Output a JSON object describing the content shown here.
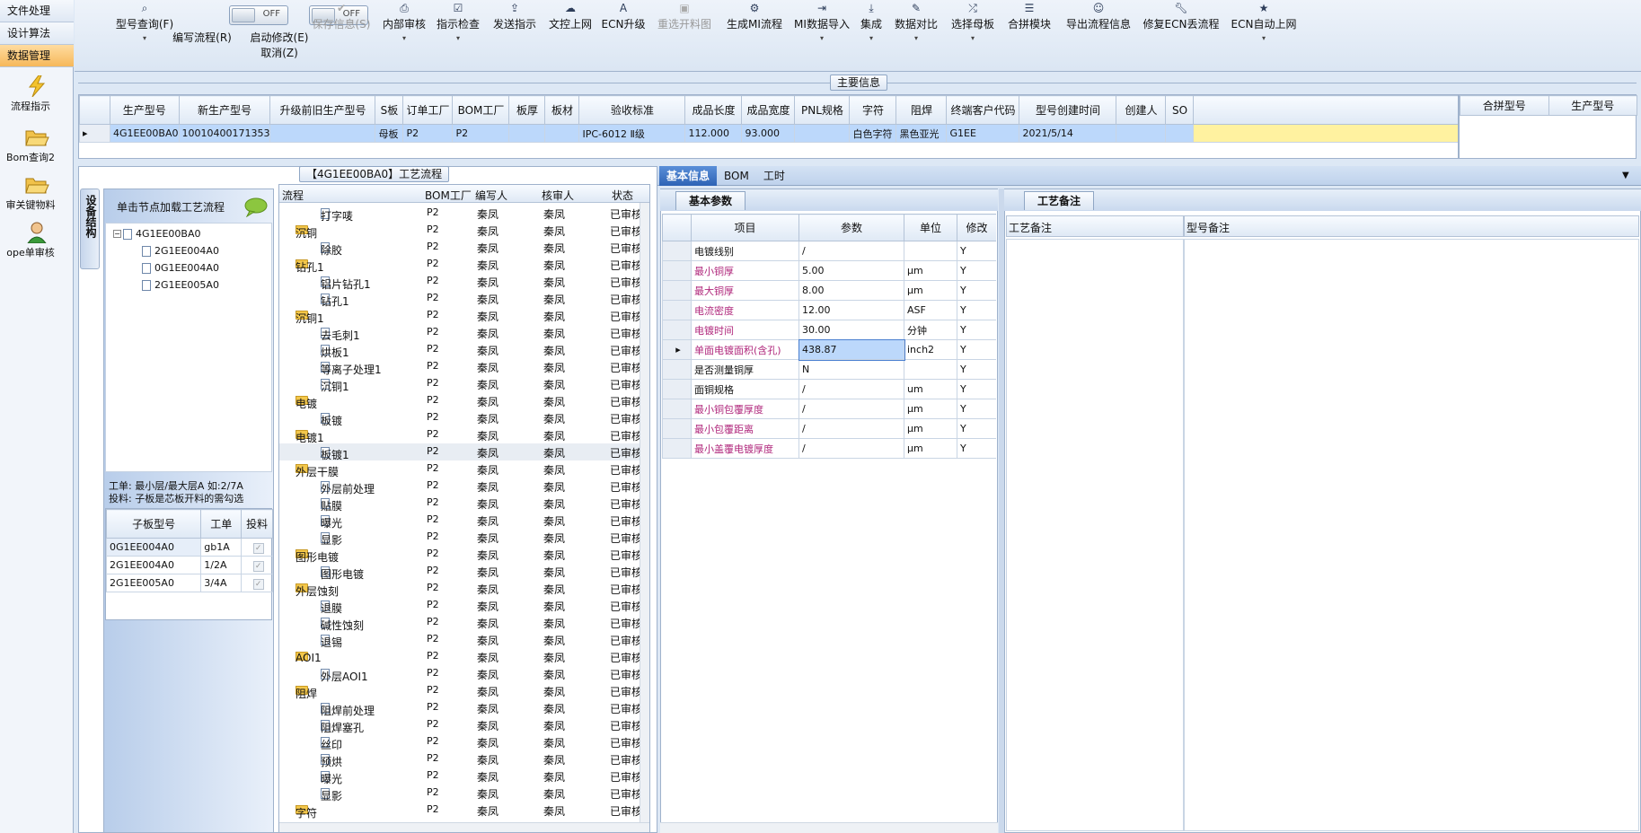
{
  "nav": {
    "tabs": [
      "文件处理",
      "设计算法",
      "数据管理"
    ],
    "items": [
      {
        "label": "流程指示",
        "icon": "lightning-icon"
      },
      {
        "label": "Bom查询2",
        "icon": "folder-open-icon"
      },
      {
        "label": "审关键物料",
        "icon": "folder-open-icon"
      },
      {
        "label": "ope单审核",
        "icon": "user-icon"
      }
    ]
  },
  "toolbar": {
    "items": [
      {
        "label": "型号查询(F)",
        "icon": "search-icon",
        "sub": "▾"
      },
      {
        "label": "编写流程(R)",
        "icon": "toggle-icon",
        "toggle": "OFF"
      },
      {
        "label": "启动修改(E)",
        "icon": "toggle-icon",
        "toggle": "OFF",
        "sub": "取消(Z)"
      },
      {
        "label": "保存信息(S)",
        "icon": "check-icon",
        "disabled": true
      },
      {
        "label": "内部审核",
        "icon": "print-icon",
        "sub": "▾"
      },
      {
        "label": "指示检查",
        "icon": "check-square-icon",
        "sub": "▾"
      },
      {
        "label": "发送指示",
        "icon": "upload-icon"
      },
      {
        "label": "文控上网",
        "icon": "cloud-upload-icon"
      },
      {
        "label": "ECN升级",
        "icon": "font-icon"
      },
      {
        "label": "重选开料图",
        "icon": "image-icon",
        "disabled": true
      },
      {
        "label": "生成MI流程",
        "icon": "gears-icon"
      },
      {
        "label": "MI数据导入",
        "icon": "sign-in-icon",
        "sub": "▾"
      },
      {
        "label": "集成",
        "icon": "download-icon",
        "sub": "▾"
      },
      {
        "label": "数据对比",
        "icon": "magic-icon",
        "sub": "▾"
      },
      {
        "label": "选择母板",
        "icon": "random-icon",
        "sub": "▾"
      },
      {
        "label": "合拼模块",
        "icon": "list-icon"
      },
      {
        "label": "导出流程信息",
        "icon": "smile-icon"
      },
      {
        "label": "修复ECN丢流程",
        "icon": "wrench-icon"
      },
      {
        "label": "ECN自动上网",
        "icon": "star-icon",
        "sub": "▾"
      }
    ]
  },
  "main_info": {
    "title": "主要信息",
    "columns": [
      "生产型号",
      "新生产型号",
      "升级前旧生产型号",
      "S板",
      "订单工厂",
      "BOM工厂",
      "板厚",
      "板材",
      "验收标准",
      "成品长度",
      "成品宽度",
      "PNL规格",
      "字符",
      "阻焊",
      "终端客户代码",
      "型号创建时间",
      "创建人",
      "SO"
    ],
    "row": [
      "4G1EE00BA0",
      "10010400171353",
      "",
      "母板",
      "P2",
      "P2",
      "",
      "",
      "IPC-6012 Ⅱ级",
      "112.000",
      "93.000",
      "",
      "白色字符",
      "黑色亚光",
      "G1EE",
      "2021/5/14",
      "",
      ""
    ],
    "side_columns": [
      "合拼型号",
      "生产型号"
    ]
  },
  "process": {
    "title": "【4G1EE00BA0】工艺流程",
    "side_tab": "设备结构",
    "hint": "单击节点加载工艺流程",
    "tree": [
      "4G1EE00BA0",
      "2G1EE004A0",
      "0G1EE004A0",
      "2G1EE005A0"
    ],
    "info_line1": "工单: 最小层/最大层A 如:2/7A",
    "info_line2": "投料: 子板是芯板开料的需勾选",
    "sub_columns": [
      "子板型号",
      "工单",
      "投料"
    ],
    "sub_rows": [
      {
        "model": "0G1EE004A0",
        "order": "gb1A"
      },
      {
        "model": "2G1EE004A0",
        "order": "1/2A"
      },
      {
        "model": "2G1EE005A0",
        "order": "3/4A"
      }
    ],
    "flow_columns": [
      "流程",
      "BOM工厂",
      "编写人",
      "核审人",
      "状态"
    ],
    "flow_rows": [
      {
        "name": "打字唛",
        "level": 2,
        "factory": "P2",
        "writer": "秦凤",
        "checker": "秦凤",
        "status": "已审核"
      },
      {
        "name": "沉铜",
        "level": 1,
        "factory": "P2",
        "writer": "秦凤",
        "checker": "秦凤",
        "status": "已审核"
      },
      {
        "name": "除胶",
        "level": 2,
        "factory": "P2",
        "writer": "秦凤",
        "checker": "秦凤",
        "status": "已审核"
      },
      {
        "name": "钻孔1",
        "level": 1,
        "factory": "P2",
        "writer": "秦凤",
        "checker": "秦凤",
        "status": "已审核"
      },
      {
        "name": "铝片钻孔1",
        "level": 2,
        "factory": "P2",
        "writer": "秦凤",
        "checker": "秦凤",
        "status": "已审核"
      },
      {
        "name": "钻孔1",
        "level": 2,
        "factory": "P2",
        "writer": "秦凤",
        "checker": "秦凤",
        "status": "已审核"
      },
      {
        "name": "沉铜1",
        "level": 1,
        "factory": "P2",
        "writer": "秦凤",
        "checker": "秦凤",
        "status": "已审核"
      },
      {
        "name": "去毛刺1",
        "level": 2,
        "factory": "P2",
        "writer": "秦凤",
        "checker": "秦凤",
        "status": "已审核"
      },
      {
        "name": "烘板1",
        "level": 2,
        "factory": "P2",
        "writer": "秦凤",
        "checker": "秦凤",
        "status": "已审核"
      },
      {
        "name": "等离子处理1",
        "level": 2,
        "factory": "P2",
        "writer": "秦凤",
        "checker": "秦凤",
        "status": "已审核"
      },
      {
        "name": "沉铜1",
        "level": 2,
        "factory": "P2",
        "writer": "秦凤",
        "checker": "秦凤",
        "status": "已审核"
      },
      {
        "name": "电镀",
        "level": 1,
        "factory": "P2",
        "writer": "秦凤",
        "checker": "秦凤",
        "status": "已审核"
      },
      {
        "name": "板镀",
        "level": 2,
        "factory": "P2",
        "writer": "秦凤",
        "checker": "秦凤",
        "status": "已审核"
      },
      {
        "name": "电镀1",
        "level": 1,
        "factory": "P2",
        "writer": "秦凤",
        "checker": "秦凤",
        "status": "已审核"
      },
      {
        "name": "板镀1",
        "level": 2,
        "factory": "P2",
        "writer": "秦凤",
        "checker": "秦凤",
        "status": "已审核",
        "selected": true
      },
      {
        "name": "外层干膜",
        "level": 1,
        "factory": "P2",
        "writer": "秦凤",
        "checker": "秦凤",
        "status": "已审核"
      },
      {
        "name": "外层前处理",
        "level": 2,
        "factory": "P2",
        "writer": "秦凤",
        "checker": "秦凤",
        "status": "已审核"
      },
      {
        "name": "贴膜",
        "level": 2,
        "factory": "P2",
        "writer": "秦凤",
        "checker": "秦凤",
        "status": "已审核"
      },
      {
        "name": "曝光",
        "level": 2,
        "factory": "P2",
        "writer": "秦凤",
        "checker": "秦凤",
        "status": "已审核"
      },
      {
        "name": "显影",
        "level": 2,
        "factory": "P2",
        "writer": "秦凤",
        "checker": "秦凤",
        "status": "已审核"
      },
      {
        "name": "图形电镀",
        "level": 1,
        "factory": "P2",
        "writer": "秦凤",
        "checker": "秦凤",
        "status": "已审核"
      },
      {
        "name": "图形电镀",
        "level": 2,
        "factory": "P2",
        "writer": "秦凤",
        "checker": "秦凤",
        "status": "已审核"
      },
      {
        "name": "外层蚀刻",
        "level": 1,
        "factory": "P2",
        "writer": "秦凤",
        "checker": "秦凤",
        "status": "已审核"
      },
      {
        "name": "退膜",
        "level": 2,
        "factory": "P2",
        "writer": "秦凤",
        "checker": "秦凤",
        "status": "已审核"
      },
      {
        "name": "碱性蚀刻",
        "level": 2,
        "factory": "P2",
        "writer": "秦凤",
        "checker": "秦凤",
        "status": "已审核"
      },
      {
        "name": "退锡",
        "level": 2,
        "factory": "P2",
        "writer": "秦凤",
        "checker": "秦凤",
        "status": "已审核"
      },
      {
        "name": "AOI1",
        "level": 1,
        "factory": "P2",
        "writer": "秦凤",
        "checker": "秦凤",
        "status": "已审核"
      },
      {
        "name": "外层AOI1",
        "level": 2,
        "factory": "P2",
        "writer": "秦凤",
        "checker": "秦凤",
        "status": "已审核"
      },
      {
        "name": "阻焊",
        "level": 1,
        "factory": "P2",
        "writer": "秦凤",
        "checker": "秦凤",
        "status": "已审核"
      },
      {
        "name": "阻焊前处理",
        "level": 2,
        "factory": "P2",
        "writer": "秦凤",
        "checker": "秦凤",
        "status": "已审核"
      },
      {
        "name": "阻焊塞孔",
        "level": 2,
        "factory": "P2",
        "writer": "秦凤",
        "checker": "秦凤",
        "status": "已审核"
      },
      {
        "name": "丝印",
        "level": 2,
        "factory": "P2",
        "writer": "秦凤",
        "checker": "秦凤",
        "status": "已审核"
      },
      {
        "name": "预烘",
        "level": 2,
        "factory": "P2",
        "writer": "秦凤",
        "checker": "秦凤",
        "status": "已审核"
      },
      {
        "name": "曝光",
        "level": 2,
        "factory": "P2",
        "writer": "秦凤",
        "checker": "秦凤",
        "status": "已审核"
      },
      {
        "name": "显影",
        "level": 2,
        "factory": "P2",
        "writer": "秦凤",
        "checker": "秦凤",
        "status": "已审核"
      },
      {
        "name": "字符",
        "level": 1,
        "factory": "P2",
        "writer": "秦凤",
        "checker": "秦凤",
        "status": "已审核"
      }
    ]
  },
  "detail": {
    "tabs": [
      "基本信息",
      "BOM",
      "工时"
    ],
    "params_tab": "基本参数",
    "columns": [
      "项目",
      "参数",
      "单位",
      "修改"
    ],
    "rows": [
      {
        "item": "电镀线别",
        "value": "/",
        "unit": "",
        "mod": "Y",
        "hl": false
      },
      {
        "item": "最小铜厚",
        "value": "5.00",
        "unit": "μm",
        "mod": "Y",
        "hl": true
      },
      {
        "item": "最大铜厚",
        "value": "8.00",
        "unit": "μm",
        "mod": "Y",
        "hl": true
      },
      {
        "item": "电流密度",
        "value": "12.00",
        "unit": "ASF",
        "mod": "Y",
        "hl": true
      },
      {
        "item": "电镀时间",
        "value": "30.00",
        "unit": "分钟",
        "mod": "Y",
        "hl": true
      },
      {
        "item": "单面电镀面积(含孔)",
        "value": "438.87",
        "unit": "inch2",
        "mod": "Y",
        "hl": true,
        "current": true
      },
      {
        "item": "是否测量铜厚",
        "value": "N",
        "unit": "",
        "mod": "Y",
        "hl": false
      },
      {
        "item": "面铜规格",
        "value": "/",
        "unit": "um",
        "mod": "Y",
        "hl": false
      },
      {
        "item": "最小铜包覆厚度",
        "value": "/",
        "unit": "μm",
        "mod": "Y",
        "hl": true
      },
      {
        "item": "最小包覆距离",
        "value": "/",
        "unit": "μm",
        "mod": "Y",
        "hl": true
      },
      {
        "item": "最小盖覆电镀厚度",
        "value": "/",
        "unit": "μm",
        "mod": "Y",
        "hl": true
      }
    ]
  },
  "remarks": {
    "tab": "工艺备注",
    "col1": "工艺备注",
    "col2": "型号备注"
  }
}
